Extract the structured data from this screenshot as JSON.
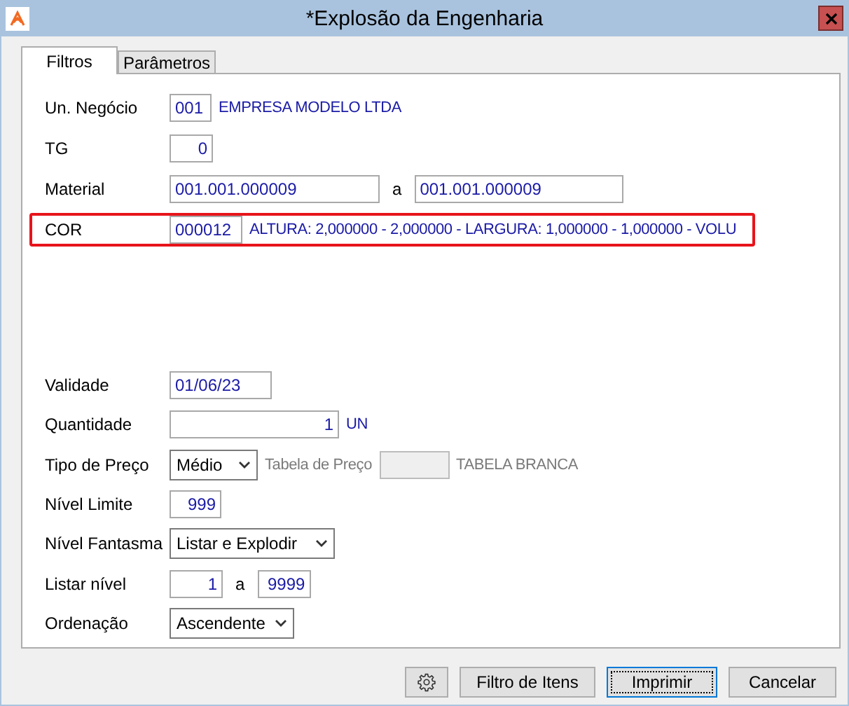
{
  "window": {
    "title": "*Explosão da Engenharia"
  },
  "tabs": [
    {
      "label": "Filtros",
      "selected": true
    },
    {
      "label": "Parâmetros",
      "selected": false
    }
  ],
  "upper_rows": [
    {
      "label": "Un. Negócio",
      "highlighted": false,
      "items": [
        {
          "kind": "input",
          "value": "001"
        },
        {
          "kind": "text",
          "value": "EMPRESA MODELO LTDA",
          "disabled": false
        }
      ]
    },
    {
      "label": "TG",
      "highlighted": false,
      "items": [
        {
          "kind": "number",
          "value": "0"
        }
      ]
    },
    {
      "label": "Material",
      "highlighted": false,
      "items": [
        {
          "kind": "input",
          "value": "001.001.000009"
        },
        {
          "kind": "sep",
          "value": "a"
        },
        {
          "kind": "input",
          "value": "001.001.000009"
        }
      ]
    },
    {
      "label": "COR",
      "highlighted": true,
      "items": [
        {
          "kind": "input",
          "value": "000012"
        },
        {
          "kind": "text",
          "value": "ALTURA: 2,000000 - 2,000000 - LARGURA: 1,000000 - 1,000000 - VOLU",
          "disabled": false
        }
      ]
    }
  ],
  "lower_rows": [
    {
      "label": "Validade",
      "highlighted": false,
      "items": [
        {
          "kind": "input",
          "value": "01/06/23"
        }
      ]
    },
    {
      "label": "Quantidade",
      "highlighted": false,
      "items": [
        {
          "kind": "number",
          "value": "1"
        },
        {
          "kind": "text",
          "value": "UN",
          "disabled": false
        }
      ]
    },
    {
      "label": "Tipo de Preço",
      "highlighted": false,
      "items": [
        {
          "kind": "select",
          "value": "Médio"
        },
        {
          "kind": "text",
          "value": "Tabela de Preço",
          "disabled": true
        },
        {
          "kind": "input",
          "disabled": true
        },
        {
          "kind": "text",
          "value": "TABELA BRANCA",
          "disabled": true
        }
      ]
    },
    {
      "label": "Nível Limite",
      "highlighted": false,
      "items": [
        {
          "kind": "number",
          "value": "999"
        }
      ]
    },
    {
      "label": "Nível Fantasma",
      "highlighted": false,
      "items": [
        {
          "kind": "select",
          "value": "Listar e Explodir"
        }
      ]
    },
    {
      "label": "Listar nível",
      "highlighted": false,
      "items": [
        {
          "kind": "number",
          "value": "1"
        },
        {
          "kind": "sep",
          "value": "a"
        },
        {
          "kind": "number",
          "value": "9999"
        }
      ]
    },
    {
      "label": "Ordenação",
      "highlighted": false,
      "items": [
        {
          "kind": "select",
          "value": "Ascendente"
        }
      ]
    }
  ],
  "buttons": [
    {
      "kind": "icon",
      "focused": false
    },
    {
      "kind": "text",
      "label": "Filtro de Itens",
      "focused": false
    },
    {
      "kind": "text",
      "label": "Imprimir",
      "focused": true
    },
    {
      "kind": "text",
      "label": "Cancelar",
      "focused": false
    }
  ]
}
